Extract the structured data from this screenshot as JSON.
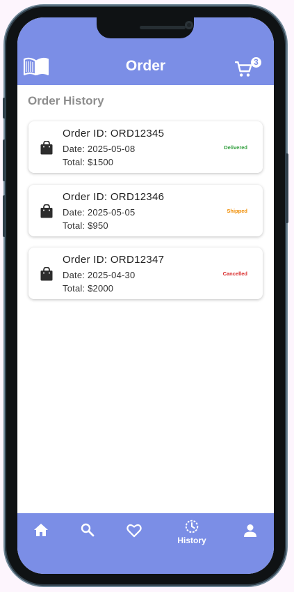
{
  "appbar": {
    "title": "Order",
    "cart_count": "3"
  },
  "section": {
    "title": "Order History"
  },
  "orders": [
    {
      "id": "Order ID: ORD12345",
      "date": "Date: 2025-05-08",
      "total": "Total: $1500",
      "status": "Delivered",
      "status_color": "#2e9d3a"
    },
    {
      "id": "Order ID: ORD12346",
      "date": "Date: 2025-05-05",
      "total": "Total: $950",
      "status": "Shipped",
      "status_color": "#f08c00"
    },
    {
      "id": "Order ID: ORD12347",
      "date": "Date: 2025-04-30",
      "total": "Total: $2000",
      "status": "Cancelled",
      "status_color": "#d92b2b"
    }
  ],
  "bottom_nav": {
    "items": [
      {
        "icon": "home-icon"
      },
      {
        "icon": "search-icon"
      },
      {
        "icon": "heart-icon"
      },
      {
        "icon": "history-icon",
        "label": "History",
        "active": true
      },
      {
        "icon": "person-icon"
      }
    ]
  },
  "colors": {
    "primary": "#7b8ee6",
    "card_bg": "#ffffff",
    "section_title": "#8e8e8e"
  }
}
